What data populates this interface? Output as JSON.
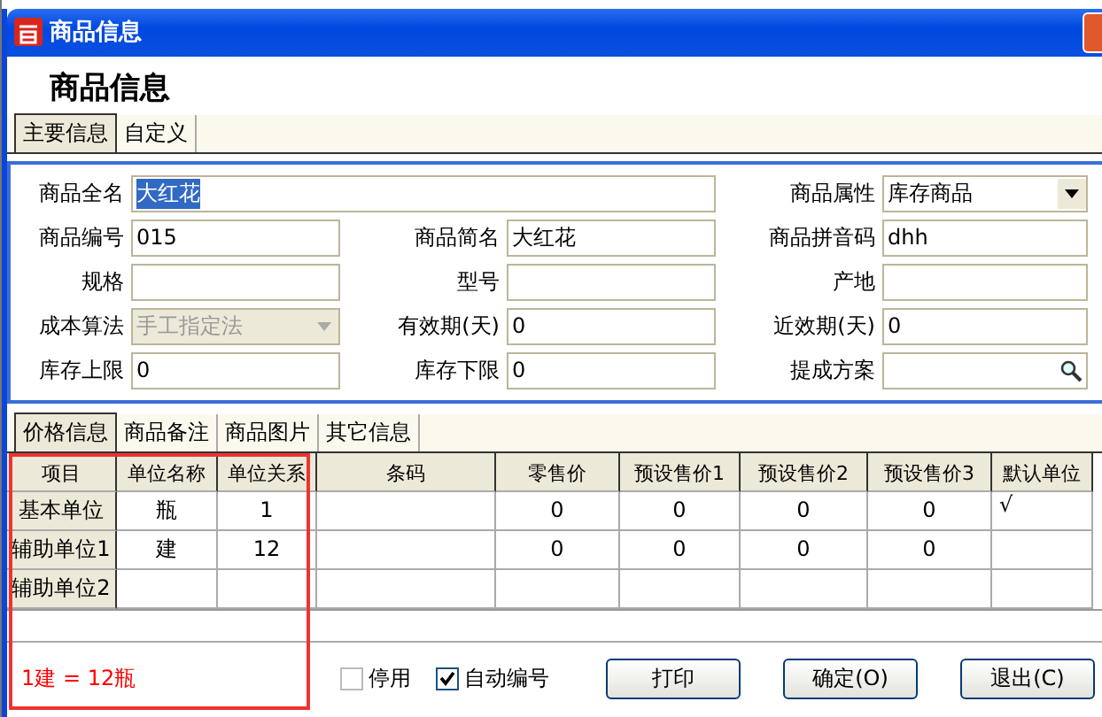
{
  "window": {
    "title": "商品信息"
  },
  "heading": "商品信息",
  "tabs": [
    {
      "label": "主要信息",
      "selected": true
    },
    {
      "label": "自定义",
      "selected": false
    }
  ],
  "fields": [
    {
      "label": "商品全名",
      "value": "大红花",
      "kind": "wide",
      "text_selected": true
    },
    {
      "label": "商品属性",
      "value": "库存商品",
      "kind": "select",
      "text_selected": false
    },
    {
      "label": "商品编号",
      "value": "015",
      "kind": "text",
      "text_selected": false
    },
    {
      "label": "商品简名",
      "value": "大红花",
      "kind": "text",
      "text_selected": false
    },
    {
      "label": "商品拼音码",
      "value": "dhh",
      "kind": "text",
      "text_selected": false
    },
    {
      "label": "规格",
      "kind": "text"
    },
    {
      "label": "型号",
      "kind": "text"
    },
    {
      "label": "产地",
      "kind": "text"
    },
    {
      "label": "成本算法",
      "value": "手工指定法",
      "kind": "select",
      "disabled": true,
      "text_selected": false
    },
    {
      "label": "有效期(天)",
      "value": "0",
      "kind": "text",
      "text_selected": false
    },
    {
      "label": "近效期(天)",
      "value": "0",
      "kind": "text",
      "text_selected": false
    },
    {
      "label": "库存上限",
      "value": "0",
      "kind": "text",
      "text_selected": false
    },
    {
      "label": "库存下限",
      "value": "0",
      "kind": "text",
      "text_selected": false
    },
    {
      "label": "提成方案",
      "kind": "lookup"
    }
  ],
  "lower_tabs": [
    {
      "label": "价格信息",
      "selected": true
    },
    {
      "label": "商品备注",
      "selected": false
    },
    {
      "label": "商品图片",
      "selected": false
    },
    {
      "label": "其它信息",
      "selected": false
    }
  ],
  "table": {
    "columns": [
      "项目",
      "单位名称",
      "单位关系",
      "条码",
      "零售价",
      "预设售价1",
      "预设售价2",
      "预设售价3",
      "默认单位"
    ],
    "rows": [
      [
        "基本单位",
        "瓶",
        "1",
        "",
        "0",
        "0",
        "0",
        "0",
        "√"
      ],
      [
        "辅助单位1",
        "建",
        "12",
        "",
        "0",
        "0",
        "0",
        "0",
        ""
      ],
      [
        "辅助单位2",
        "",
        "",
        "",
        "",
        "",
        "",
        "",
        ""
      ]
    ]
  },
  "note": "1建 = 12瓶",
  "checkboxes": [
    {
      "label": "停用",
      "checked": false
    },
    {
      "label": "自动编号",
      "checked": true
    }
  ],
  "buttons": [
    "打印",
    "确定(O)",
    "退出(C)"
  ]
}
